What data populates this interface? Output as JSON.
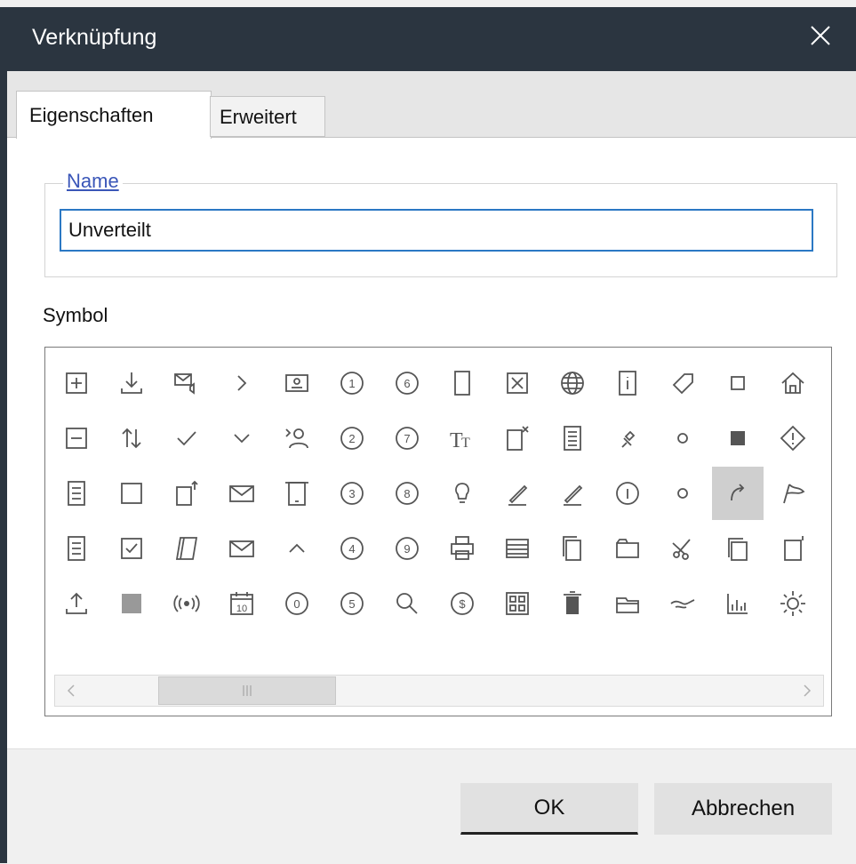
{
  "window": {
    "title": "Verknüpfung"
  },
  "tabs": [
    {
      "label": "Eigenschaften",
      "active": true
    },
    {
      "label": "Erweitert",
      "active": false
    }
  ],
  "name_group": {
    "legend": "Name",
    "value": "Unverteilt"
  },
  "symbol": {
    "label": "Symbol",
    "selected": "curve-arrow-icon",
    "rows": [
      [
        "plus-box-icon",
        "download-icon",
        "mail-sound-icon",
        "chevron-right-icon",
        "contact-card-icon",
        "circle-1-icon",
        "circle-6-icon",
        "page-icon",
        "x-box-icon",
        "globe-icon",
        "info-doc-icon",
        "tag-icon",
        "square-icon",
        "home-icon"
      ],
      [
        "minus-box-icon",
        "sort-arrows-icon",
        "checkmark-icon",
        "chevron-down-icon",
        "users-icon",
        "circle-2-icon",
        "circle-7-icon",
        "font-size-icon",
        "doc-x-icon",
        "document-lines-icon",
        "pin-icon",
        "small-circle-icon",
        "filled-square-icon",
        "warning-shield-icon"
      ],
      [
        "list-doc-icon",
        "empty-square-icon",
        "doc-up-icon",
        "envelope-icon",
        "tablet-icon",
        "circle-3-icon",
        "circle-8-icon",
        "lightbulb-icon",
        "pen-icon",
        "pen-alt-icon",
        "circle-i-icon",
        "small-circle-alt-icon",
        "curve-arrow-icon",
        "flag-icon"
      ],
      [
        "list-doc-alt-icon",
        "checked-box-icon",
        "notebook-icon",
        "envelope-alt-icon",
        "caret-up-icon",
        "circle-4-icon",
        "circle-9-icon",
        "printer-icon",
        "table-icon",
        "copy-icon",
        "folder-alt-icon",
        "scissors-icon",
        "pages-icon",
        "doc-corner-icon"
      ],
      [
        "upload-icon",
        "checker-pattern-icon",
        "broadcast-icon",
        "calendar-10-icon",
        "circle-0-icon",
        "circle-5-icon",
        "magnifier-icon",
        "dollar-circle-icon",
        "apps-grid-icon",
        "trash-icon",
        "folder-open-icon",
        "handshake-icon",
        "bar-chart-icon",
        "sun-icon"
      ]
    ]
  },
  "buttons": {
    "ok": "OK",
    "cancel": "Abbrechen"
  },
  "colors": {
    "titlebar": "#2b3540",
    "accent": "#2b78c4",
    "legend": "#3a56b8",
    "selection": "#cfcfcf"
  }
}
